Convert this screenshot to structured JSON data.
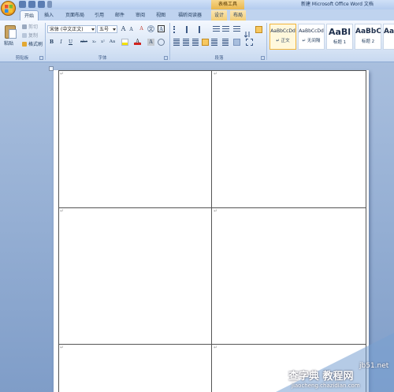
{
  "titlebar": {
    "context_tab_title": "表格工具",
    "doc_title": "新建 Microsoft Office Word 文档"
  },
  "tabs": [
    "开始",
    "插入",
    "页面布局",
    "引用",
    "邮件",
    "审阅",
    "视图",
    "福昕阅读器",
    "设计",
    "布局"
  ],
  "clipboard": {
    "paste": "粘贴",
    "cut": "剪切",
    "copy": "复制",
    "format_painter": "格式刷",
    "group_label": "剪贴板"
  },
  "font": {
    "font_name": "宋体 (中文正文)",
    "font_size": "五号",
    "grow": "A",
    "shrink": "A",
    "clear": "A",
    "wen": "文",
    "bold": "B",
    "italic": "I",
    "underline": "U",
    "strike": "abc",
    "subscript": "x₂",
    "superscript": "x²",
    "change_case": "Aa",
    "font_color_letter": "A",
    "char_shading": "A",
    "group_label": "字体"
  },
  "paragraph": {
    "group_label": "段落"
  },
  "styles": {
    "items": [
      {
        "sample": "AaBbCcDd",
        "name": "↵ 正文"
      },
      {
        "sample": "AaBbCcDd",
        "name": "↵ 无间隔"
      },
      {
        "sample": "AaBl",
        "name": "标题 1"
      },
      {
        "sample": "AaBbC",
        "name": "标题 2"
      },
      {
        "sample": "Aa",
        "name": ""
      }
    ]
  },
  "table": {
    "cell_marker": "↵"
  },
  "watermark": {
    "line1": "查字典 教程网",
    "line2": "jb51.net",
    "line3": "jiaocheng.chazidian.com"
  },
  "colors": {
    "accent": "#f2b43a",
    "ribbon": "#dae6f6",
    "workspace": "#8ea9cf"
  }
}
